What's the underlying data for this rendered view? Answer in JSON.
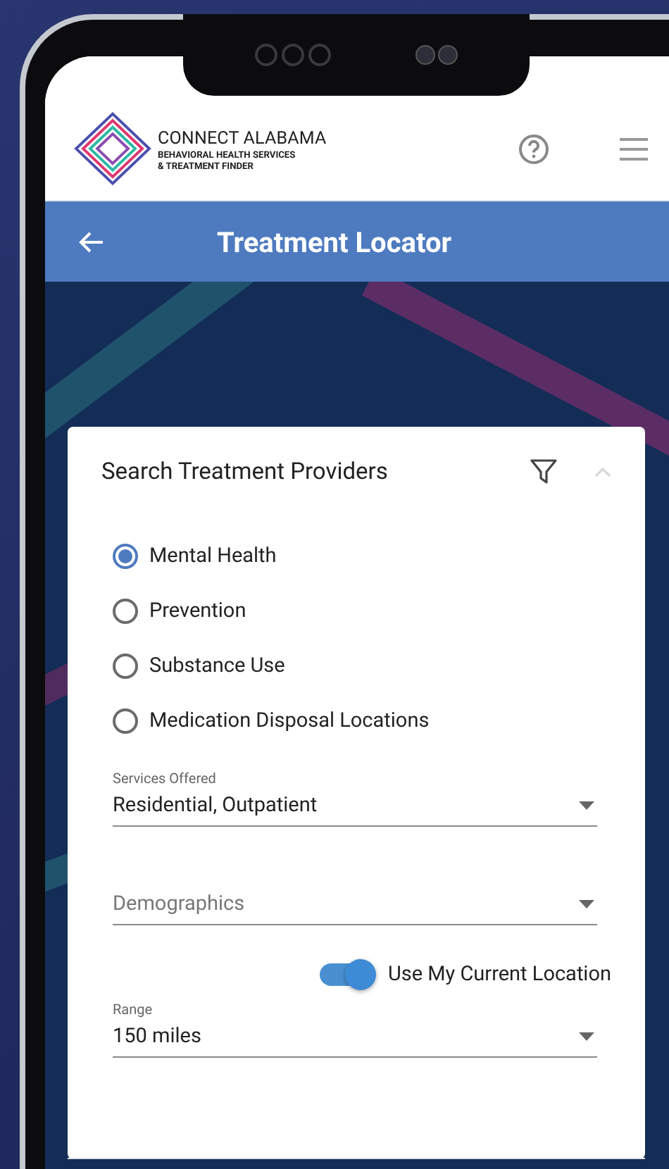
{
  "header": {
    "logo": {
      "title": "CONNECT ALABAMA",
      "subtitle_1": "BEHAVIORAL HEALTH SERVICES",
      "subtitle_2": "& TREATMENT FINDER"
    }
  },
  "toolbar": {
    "title": "Treatment Locator"
  },
  "card": {
    "title": "Search Treatment Providers",
    "expanded": true,
    "categories": [
      {
        "label": "Mental Health",
        "selected": true
      },
      {
        "label": "Prevention",
        "selected": false
      },
      {
        "label": "Substance Use",
        "selected": false
      },
      {
        "label": "Medication Disposal Locations",
        "selected": false
      }
    ],
    "fields": [
      {
        "label": "Services Offered",
        "value": "Residential, Outpatient"
      },
      {
        "placeholder": "Demographics"
      }
    ],
    "location_toggle": {
      "label": "Use My Current Location",
      "on": true
    },
    "range": {
      "label": "Range",
      "value": "150 miles"
    }
  }
}
